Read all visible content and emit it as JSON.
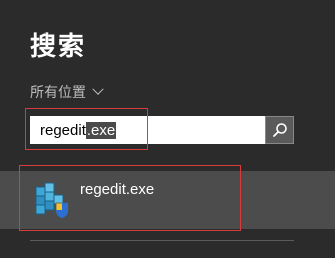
{
  "header": {
    "title": "搜索"
  },
  "scope": {
    "label": "所有位置",
    "icon": "chevron-down-icon"
  },
  "search": {
    "query_typed": "regedit",
    "query_selected": ".exe",
    "button_icon": "search-icon"
  },
  "results": [
    {
      "label": "regedit.exe",
      "icon": "registry-editor-icon"
    }
  ],
  "colors": {
    "background": "#2b2b2b",
    "result_highlight": "#4c4c4c",
    "annotation": "#d83b3b",
    "search_button": "#5a5a5a"
  }
}
